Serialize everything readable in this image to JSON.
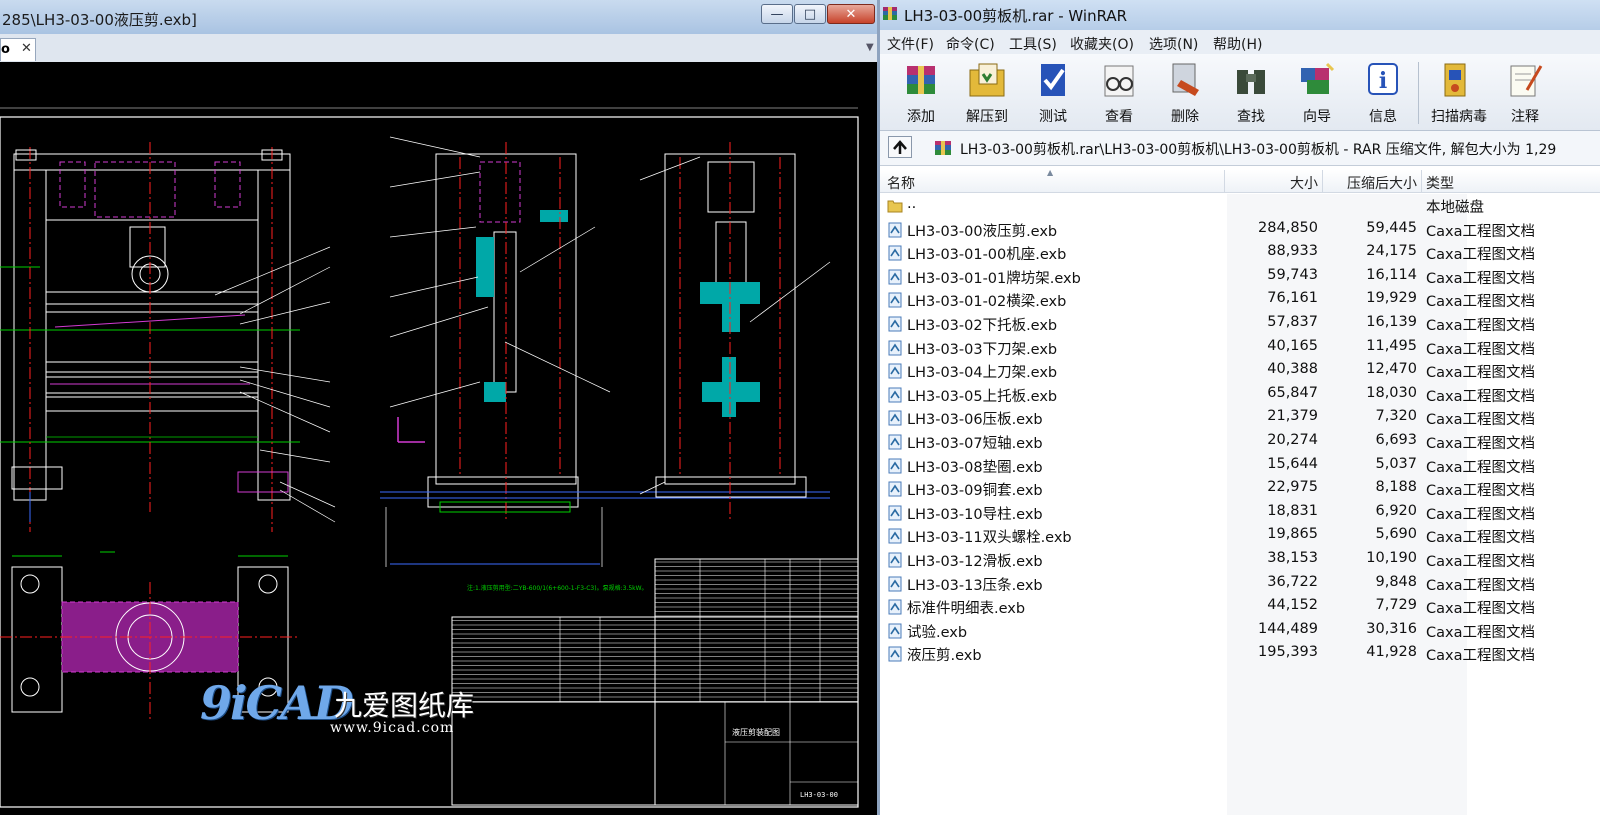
{
  "cad_window": {
    "title": "285\\LH3-03-00液压剪.exb]",
    "tab": {
      "label": "o",
      "close": "✕"
    },
    "buttons": {
      "minimize": "—",
      "maximize": "□",
      "close": "✕"
    },
    "tab_dropdown": "▼",
    "drawing_note": "注:1.液压剪用型:二YB-600/1(6+600-1-F3-C3)。泵规格:3.5kW。",
    "title_block_name": "液压剪装配图",
    "title_block_code": "LH3-03-00"
  },
  "watermark": {
    "logo": "9iCAD",
    "name": "九爱图纸库",
    "url": "www.9icad.com"
  },
  "rar_window": {
    "title": "LH3-03-00剪板机.rar - WinRAR",
    "menu": [
      "文件(F)",
      "命令(C)",
      "工具(S)",
      "收藏夹(O)",
      "选项(N)",
      "帮助(H)"
    ],
    "toolbar": [
      "添加",
      "解压到",
      "测试",
      "查看",
      "删除",
      "查找",
      "向导",
      "信息",
      "扫描病毒",
      "注释"
    ],
    "path": "LH3-03-00剪板机.rar\\LH3-03-00剪板机\\LH3-03-00剪板机 - RAR 压缩文件, 解包大小为 1,29",
    "columns": {
      "name": "名称",
      "size": "大小",
      "packed": "压缩后大小",
      "type": "类型"
    },
    "parent_row": {
      "name": "..",
      "type": "本地磁盘"
    },
    "files": [
      {
        "name": "LH3-03-00液压剪.exb",
        "size": "284,850",
        "packed": "59,445",
        "type": "Caxa工程图文档"
      },
      {
        "name": "LH3-03-01-00机座.exb",
        "size": "88,933",
        "packed": "24,175",
        "type": "Caxa工程图文档"
      },
      {
        "name": "LH3-03-01-01牌坊架.exb",
        "size": "59,743",
        "packed": "16,114",
        "type": "Caxa工程图文档"
      },
      {
        "name": "LH3-03-01-02横梁.exb",
        "size": "76,161",
        "packed": "19,929",
        "type": "Caxa工程图文档"
      },
      {
        "name": "LH3-03-02下托板.exb",
        "size": "57,837",
        "packed": "16,139",
        "type": "Caxa工程图文档"
      },
      {
        "name": "LH3-03-03下刀架.exb",
        "size": "40,165",
        "packed": "11,495",
        "type": "Caxa工程图文档"
      },
      {
        "name": "LH3-03-04上刀架.exb",
        "size": "40,388",
        "packed": "12,470",
        "type": "Caxa工程图文档"
      },
      {
        "name": "LH3-03-05上托板.exb",
        "size": "65,847",
        "packed": "18,030",
        "type": "Caxa工程图文档"
      },
      {
        "name": "LH3-03-06压板.exb",
        "size": "21,379",
        "packed": "7,320",
        "type": "Caxa工程图文档"
      },
      {
        "name": "LH3-03-07短轴.exb",
        "size": "20,274",
        "packed": "6,693",
        "type": "Caxa工程图文档"
      },
      {
        "name": "LH3-03-08垫圈.exb",
        "size": "15,644",
        "packed": "5,037",
        "type": "Caxa工程图文档"
      },
      {
        "name": "LH3-03-09铜套.exb",
        "size": "22,975",
        "packed": "8,188",
        "type": "Caxa工程图文档"
      },
      {
        "name": "LH3-03-10导柱.exb",
        "size": "18,831",
        "packed": "6,920",
        "type": "Caxa工程图文档"
      },
      {
        "name": "LH3-03-11双头螺栓.exb",
        "size": "19,865",
        "packed": "5,690",
        "type": "Caxa工程图文档"
      },
      {
        "name": "LH3-03-12滑板.exb",
        "size": "38,153",
        "packed": "10,190",
        "type": "Caxa工程图文档"
      },
      {
        "name": "LH3-03-13压条.exb",
        "size": "36,722",
        "packed": "9,848",
        "type": "Caxa工程图文档"
      },
      {
        "name": "标准件明细表.exb",
        "size": "44,152",
        "packed": "7,729",
        "type": "Caxa工程图文档"
      },
      {
        "name": "试验.exb",
        "size": "144,489",
        "packed": "30,316",
        "type": "Caxa工程图文档"
      },
      {
        "name": "液压剪.exb",
        "size": "195,393",
        "packed": "41,928",
        "type": "Caxa工程图文档"
      }
    ]
  }
}
